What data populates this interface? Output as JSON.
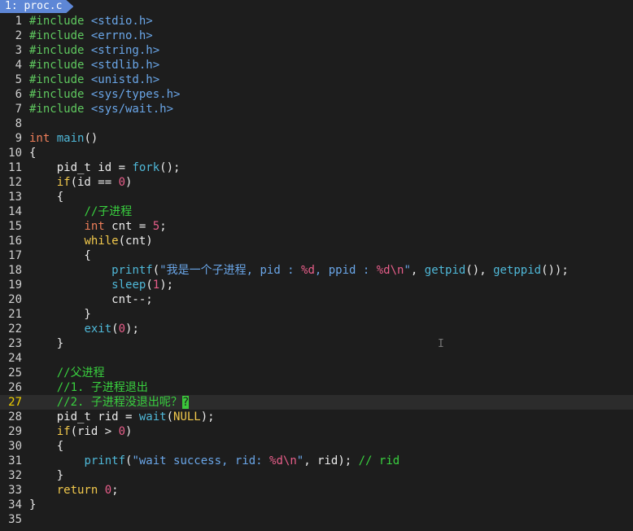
{
  "tab": {
    "label": "1: proc.c"
  },
  "lines": [
    {
      "n": "1",
      "tokens": [
        {
          "t": "#include ",
          "c": "pp"
        },
        {
          "t": "<stdio.h>",
          "c": "inc"
        }
      ]
    },
    {
      "n": "2",
      "tokens": [
        {
          "t": "#include ",
          "c": "pp"
        },
        {
          "t": "<errno.h>",
          "c": "inc"
        }
      ]
    },
    {
      "n": "3",
      "tokens": [
        {
          "t": "#include ",
          "c": "pp"
        },
        {
          "t": "<string.h>",
          "c": "inc"
        }
      ]
    },
    {
      "n": "4",
      "tokens": [
        {
          "t": "#include ",
          "c": "pp"
        },
        {
          "t": "<stdlib.h>",
          "c": "inc"
        }
      ]
    },
    {
      "n": "5",
      "tokens": [
        {
          "t": "#include ",
          "c": "pp"
        },
        {
          "t": "<unistd.h>",
          "c": "inc"
        }
      ]
    },
    {
      "n": "6",
      "tokens": [
        {
          "t": "#include ",
          "c": "pp"
        },
        {
          "t": "<sys/types.h>",
          "c": "inc"
        }
      ]
    },
    {
      "n": "7",
      "tokens": [
        {
          "t": "#include ",
          "c": "pp"
        },
        {
          "t": "<sys/wait.h>",
          "c": "inc"
        }
      ]
    },
    {
      "n": "8",
      "tokens": []
    },
    {
      "n": "9",
      "tokens": [
        {
          "t": "int",
          "c": "ty"
        },
        {
          "t": " "
        },
        {
          "t": "main",
          "c": "fn"
        },
        {
          "t": "()"
        }
      ]
    },
    {
      "n": "10",
      "tokens": [
        {
          "t": "{"
        }
      ]
    },
    {
      "n": "11",
      "tokens": [
        {
          "t": "    pid_t id = "
        },
        {
          "t": "fork",
          "c": "fn"
        },
        {
          "t": "();"
        }
      ]
    },
    {
      "n": "12",
      "tokens": [
        {
          "t": "    "
        },
        {
          "t": "if",
          "c": "kw"
        },
        {
          "t": "(id == "
        },
        {
          "t": "0",
          "c": "num"
        },
        {
          "t": ")"
        }
      ]
    },
    {
      "n": "13",
      "tokens": [
        {
          "t": "    {"
        }
      ]
    },
    {
      "n": "14",
      "tokens": [
        {
          "t": "        "
        },
        {
          "t": "//子进程",
          "c": "cm"
        }
      ]
    },
    {
      "n": "15",
      "tokens": [
        {
          "t": "        "
        },
        {
          "t": "int",
          "c": "ty"
        },
        {
          "t": " cnt = "
        },
        {
          "t": "5",
          "c": "num"
        },
        {
          "t": ";"
        }
      ]
    },
    {
      "n": "16",
      "tokens": [
        {
          "t": "        "
        },
        {
          "t": "while",
          "c": "kw"
        },
        {
          "t": "(cnt)"
        }
      ]
    },
    {
      "n": "17",
      "tokens": [
        {
          "t": "        {"
        }
      ]
    },
    {
      "n": "18",
      "tokens": [
        {
          "t": "            "
        },
        {
          "t": "printf",
          "c": "fn"
        },
        {
          "t": "("
        },
        {
          "t": "\"我是一个子进程, pid : ",
          "c": "str"
        },
        {
          "t": "%d",
          "c": "esc"
        },
        {
          "t": ", ppid : ",
          "c": "str"
        },
        {
          "t": "%d\\n",
          "c": "esc"
        },
        {
          "t": "\"",
          "c": "str"
        },
        {
          "t": ", "
        },
        {
          "t": "getpid",
          "c": "fn"
        },
        {
          "t": "(), "
        },
        {
          "t": "getppid",
          "c": "fn"
        },
        {
          "t": "());"
        }
      ]
    },
    {
      "n": "19",
      "tokens": [
        {
          "t": "            "
        },
        {
          "t": "sleep",
          "c": "fn"
        },
        {
          "t": "("
        },
        {
          "t": "1",
          "c": "num"
        },
        {
          "t": ");"
        }
      ]
    },
    {
      "n": "20",
      "tokens": [
        {
          "t": "            cnt--;"
        }
      ]
    },
    {
      "n": "21",
      "tokens": [
        {
          "t": "        }"
        }
      ]
    },
    {
      "n": "22",
      "tokens": [
        {
          "t": "        "
        },
        {
          "t": "exit",
          "c": "fn"
        },
        {
          "t": "("
        },
        {
          "t": "0",
          "c": "num"
        },
        {
          "t": ");"
        }
      ]
    },
    {
      "n": "23",
      "tokens": [
        {
          "t": "    }"
        }
      ]
    },
    {
      "n": "24",
      "tokens": []
    },
    {
      "n": "25",
      "tokens": [
        {
          "t": "    "
        },
        {
          "t": "//父进程",
          "c": "cm"
        }
      ]
    },
    {
      "n": "26",
      "tokens": [
        {
          "t": "    "
        },
        {
          "t": "//1. 子进程退出",
          "c": "cm"
        }
      ]
    },
    {
      "n": "27",
      "current": true,
      "tokens": [
        {
          "t": "    "
        },
        {
          "t": "//2. 子进程没退出呢？",
          "c": "cm"
        },
        {
          "t": "?",
          "c": "cursor"
        }
      ]
    },
    {
      "n": "28",
      "tokens": [
        {
          "t": "    pid_t rid = "
        },
        {
          "t": "wait",
          "c": "fn"
        },
        {
          "t": "("
        },
        {
          "t": "NULL",
          "c": "kw"
        },
        {
          "t": ");"
        }
      ]
    },
    {
      "n": "29",
      "tokens": [
        {
          "t": "    "
        },
        {
          "t": "if",
          "c": "kw"
        },
        {
          "t": "(rid > "
        },
        {
          "t": "0",
          "c": "num"
        },
        {
          "t": ")"
        }
      ]
    },
    {
      "n": "30",
      "tokens": [
        {
          "t": "    {"
        }
      ]
    },
    {
      "n": "31",
      "tokens": [
        {
          "t": "        "
        },
        {
          "t": "printf",
          "c": "fn"
        },
        {
          "t": "("
        },
        {
          "t": "\"wait success, rid: ",
          "c": "str"
        },
        {
          "t": "%d\\n",
          "c": "esc"
        },
        {
          "t": "\"",
          "c": "str"
        },
        {
          "t": ", rid); "
        },
        {
          "t": "// rid",
          "c": "cm"
        }
      ]
    },
    {
      "n": "32",
      "tokens": [
        {
          "t": "    }"
        }
      ]
    },
    {
      "n": "33",
      "tokens": [
        {
          "t": "    "
        },
        {
          "t": "return",
          "c": "kw"
        },
        {
          "t": " "
        },
        {
          "t": "0",
          "c": "num"
        },
        {
          "t": ";"
        }
      ]
    },
    {
      "n": "34",
      "tokens": [
        {
          "t": "}"
        }
      ]
    },
    {
      "n": "35",
      "tokens": []
    }
  ]
}
